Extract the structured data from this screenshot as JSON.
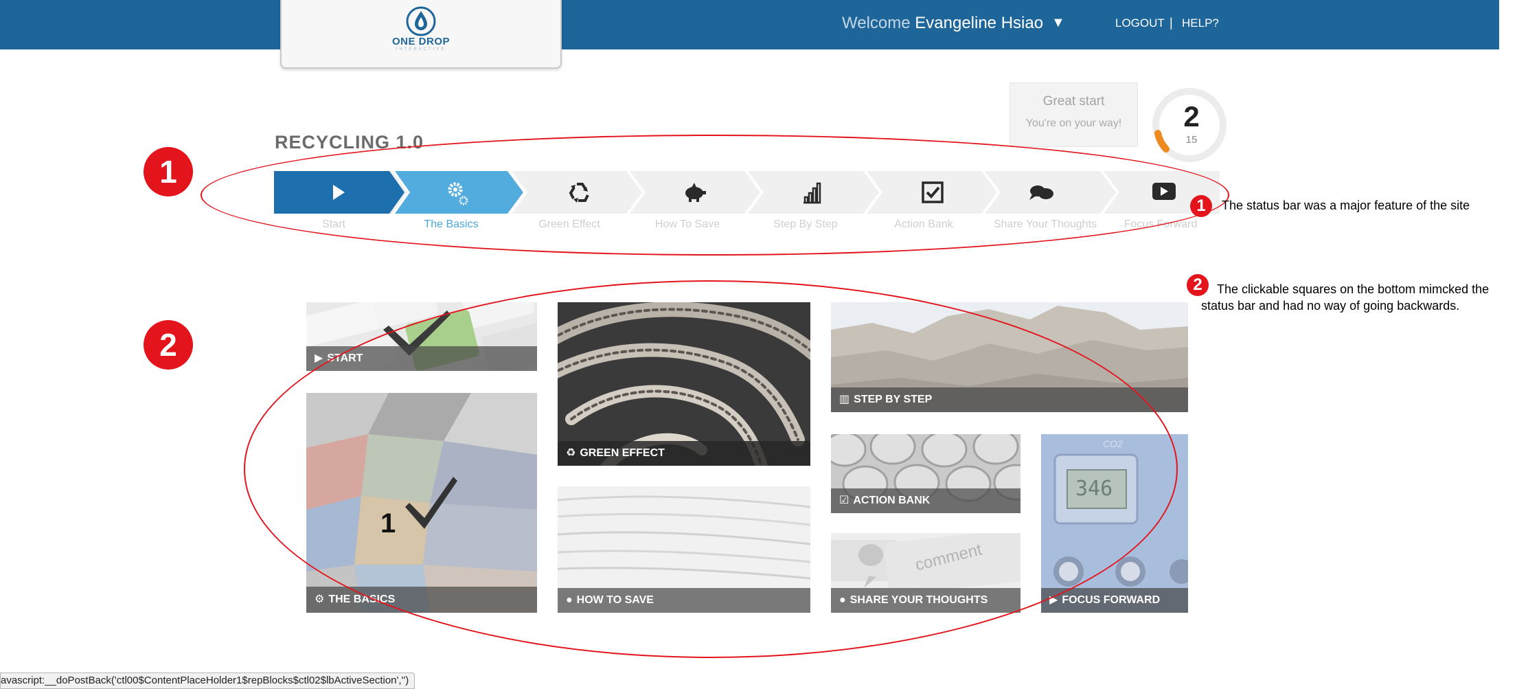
{
  "header": {
    "logo_text": "ONE DROP",
    "logo_sub": "INTERACTIVE",
    "welcome_label": "Welcome",
    "user_name": "Evangeline Hsiao",
    "user_caret": "▼",
    "logout": "LOGOUT",
    "separator": "|",
    "help": "HELP?"
  },
  "score": {
    "title": "Great start",
    "subtitle": "You're on your way!",
    "value": "2",
    "max": "15",
    "accent_color": "#ef8a1f"
  },
  "course": {
    "title": "RECYCLING 1.0"
  },
  "status_bar": {
    "steps": [
      {
        "label": "Start",
        "icon": "play-icon",
        "state": "current"
      },
      {
        "label": "The Basics",
        "icon": "gears-icon",
        "state": "done"
      },
      {
        "label": "Green Effect",
        "icon": "recycle-icon",
        "state": "locked"
      },
      {
        "label": "How To Save",
        "icon": "piggy-bank-icon",
        "state": "locked"
      },
      {
        "label": "Step By Step",
        "icon": "steps-chart-icon",
        "state": "locked"
      },
      {
        "label": "Action Bank",
        "icon": "checkbox-icon",
        "state": "locked"
      },
      {
        "label": "Share Your Thoughts",
        "icon": "comments-icon",
        "state": "locked"
      },
      {
        "label": "Focus Forward",
        "icon": "video-play-icon",
        "state": "locked"
      }
    ],
    "colors": {
      "current": "#1e6fad",
      "done": "#53acde",
      "locked": "#f0f0f0"
    }
  },
  "tiles": {
    "start": "START",
    "the_basics": "THE BASICS",
    "green_effect": "GREEN EFFECT",
    "how_to_save": "HOW TO SAVE",
    "step_by_step": "STEP BY STEP",
    "action_bank": "ACTION BANK",
    "share_your_thoughts": "SHARE YOUR THOUGHTS",
    "focus_forward": "FOCUS FORWARD",
    "basics_count": "1",
    "comment_key_text": "comment",
    "co2_text": "CO2",
    "meter_reading": "346"
  },
  "annotations": {
    "badge_1": "1",
    "badge_2": "2",
    "note_1": "The status bar was a major feature of the site",
    "note_2_line1": "The clickable squares on the bottom mimcked the",
    "note_2_line2": "status bar and had no way of going backwards.",
    "color": "#e3141c"
  },
  "browser_status": {
    "url": "avascript:__doPostBack('ctl00$ContentPlaceHolder1$repBlocks$ctl02$lbActiveSection','')"
  }
}
